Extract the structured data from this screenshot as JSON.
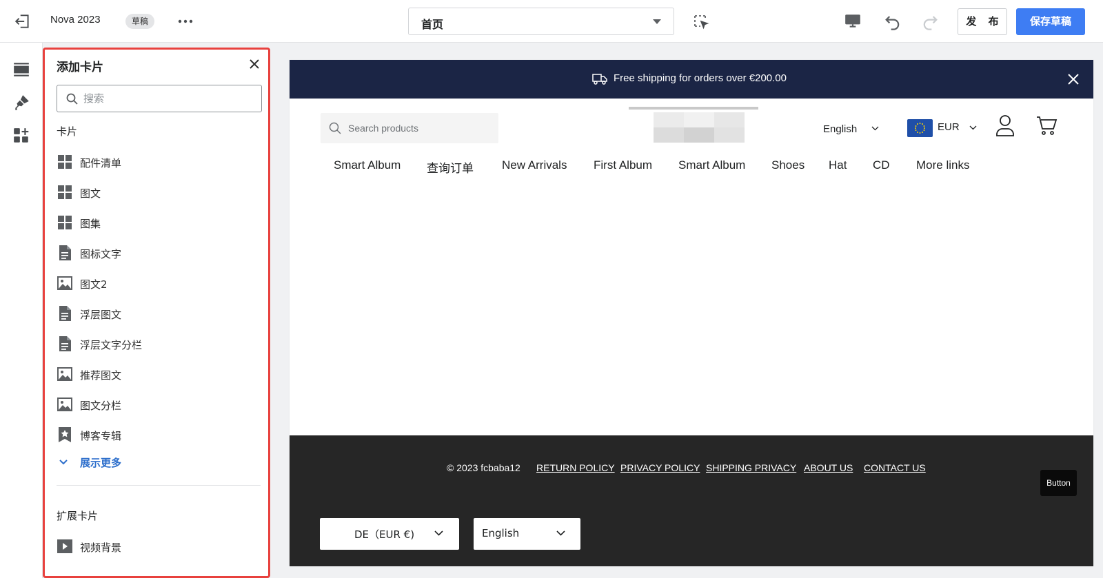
{
  "topbar": {
    "title": "Nova 2023",
    "badge": "草稿",
    "page_select": "首页",
    "publish_label": "发 布",
    "save_label": "保存草稿"
  },
  "panel": {
    "title": "添加卡片",
    "search_placeholder": "搜索",
    "section_cards": "卡片",
    "items": [
      {
        "label": "配件清单",
        "icon": "grid-icon"
      },
      {
        "label": "图文",
        "icon": "grid-icon"
      },
      {
        "label": "图集",
        "icon": "grid-icon"
      },
      {
        "label": "图标文字",
        "icon": "document-icon"
      },
      {
        "label": "图文2",
        "icon": "image-icon"
      },
      {
        "label": "浮层图文",
        "icon": "document-icon"
      },
      {
        "label": "浮层文字分栏",
        "icon": "document-icon"
      },
      {
        "label": "推荐图文",
        "icon": "image-icon"
      },
      {
        "label": "图文分栏",
        "icon": "image-icon"
      },
      {
        "label": "博客专辑",
        "icon": "bookmark-star-icon"
      }
    ],
    "show_more": "展示更多",
    "section_extended": "扩展卡片",
    "extended_items": [
      {
        "label": "视频背景",
        "icon": "video-play-icon"
      }
    ]
  },
  "preview": {
    "announcement": "Free shipping for orders over €200.00",
    "search_placeholder": "Search products",
    "language": "English",
    "currency": "EUR",
    "nav": [
      "Smart Album",
      "查询订单",
      "New Arrivals",
      "First Album",
      "Smart Album",
      "Shoes",
      "Hat",
      "CD",
      "More links"
    ],
    "footer": {
      "copyright": "© 2023 fcbaba12",
      "links": [
        "RETURN POLICY",
        "PRIVACY POLICY",
        "SHIPPING PRIVACY",
        "ABOUT US",
        "CONTACT US"
      ],
      "button": "Button",
      "country_select": "DE（EUR €)",
      "language_select": "English"
    }
  },
  "colors": {
    "primary": "#3e7df3",
    "highlight_border": "#e8413e",
    "announcement_bg": "#1b2545",
    "footer_bg": "#262626"
  }
}
